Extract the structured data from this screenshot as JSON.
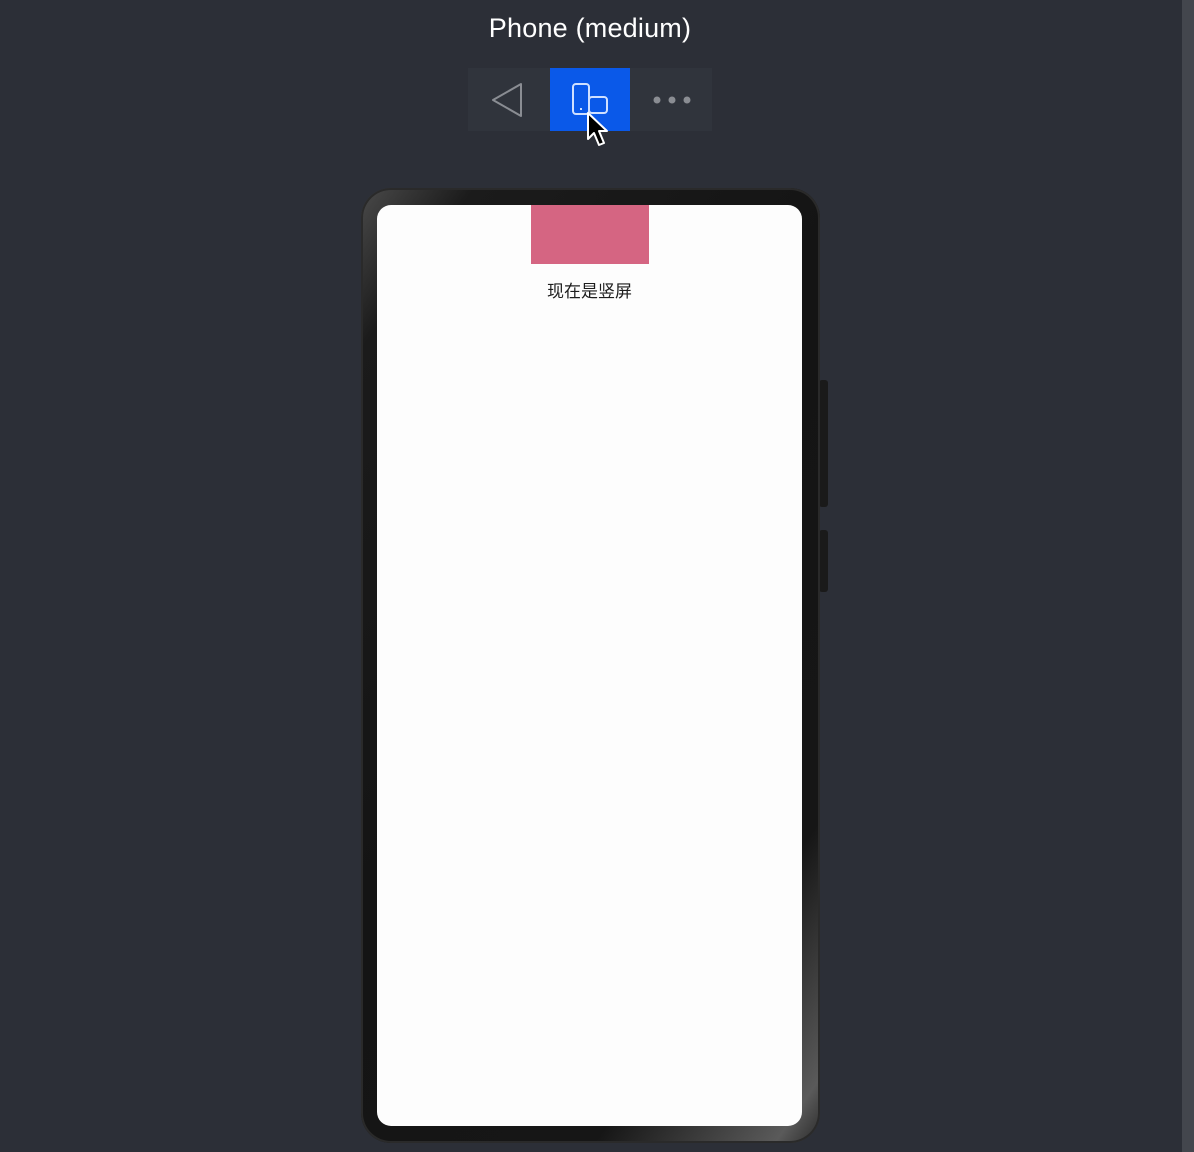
{
  "device_title": "Phone (medium)",
  "toolbar": {
    "buttons": [
      {
        "name": "back",
        "icon": "back-triangle-icon",
        "active": false
      },
      {
        "name": "rotate",
        "icon": "rotate-device-icon",
        "active": true
      },
      {
        "name": "more",
        "icon": "more-dots-icon",
        "active": false
      }
    ],
    "active_color": "#0a59e9"
  },
  "phone_screen": {
    "block_color": "#d56582",
    "orientation_text": "现在是竖屏"
  },
  "colors": {
    "background": "#2c2f37",
    "toolbar": "#30343c",
    "screen": "#fdfdfd"
  }
}
